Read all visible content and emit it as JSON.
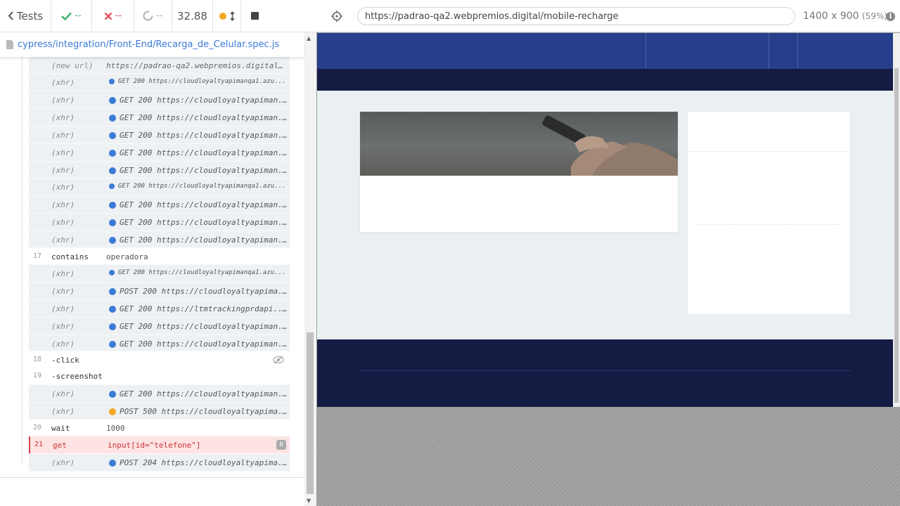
{
  "reporter": {
    "tests_label": "Tests",
    "passed": "--",
    "failed": "--",
    "pending": "--",
    "duration": "32.88",
    "spec_path": "cypress/integration/Front-End/Recarga_de_Celular.spec.js",
    "commands": [
      {
        "num": "",
        "name": "(new url)",
        "msg": "https://padrao-qa2.webpremios.digital..."
      },
      {
        "num": "",
        "name": "(xhr)",
        "msg": "GET 200 https://cloudloyaltyapimanqa1.azu...",
        "dot": "blue"
      },
      {
        "num": "",
        "name": "(xhr)",
        "msg": "GET 200 https://cloudloyaltyapiman...",
        "dot": "blue"
      },
      {
        "num": "",
        "name": "(xhr)",
        "msg": "GET 200 https://cloudloyaltyapiman...",
        "dot": "blue"
      },
      {
        "num": "",
        "name": "(xhr)",
        "msg": "GET 200 https://cloudloyaltyapiman...",
        "dot": "blue"
      },
      {
        "num": "",
        "name": "(xhr)",
        "msg": "GET 200 https://cloudloyaltyapiman...",
        "dot": "blue"
      },
      {
        "num": "",
        "name": "(xhr)",
        "msg": "GET 200 https://cloudloyaltyapiman...",
        "dot": "blue"
      },
      {
        "num": "",
        "name": "(xhr)",
        "msg": "GET 200 https://cloudloyaltyapimanqa1.azu...",
        "dot": "blue"
      },
      {
        "num": "",
        "name": "(xhr)",
        "msg": "GET 200 https://cloudloyaltyapiman...",
        "dot": "blue"
      },
      {
        "num": "",
        "name": "(xhr)",
        "msg": "GET 200 https://cloudloyaltyapiman...",
        "dot": "blue"
      },
      {
        "num": "",
        "name": "(xhr)",
        "msg": "GET 200 https://cloudloyaltyapiman...",
        "dot": "blue"
      },
      {
        "num": "17",
        "name": "contains",
        "msg": "operadora"
      },
      {
        "num": "",
        "name": "(xhr)",
        "msg": "GET 200 https://cloudloyaltyapimanqa1.azu...",
        "dot": "blue"
      },
      {
        "num": "",
        "name": "(xhr)",
        "msg": "POST 200 https://cloudloyaltyapima...",
        "dot": "blue"
      },
      {
        "num": "",
        "name": "(xhr)",
        "msg": "GET 200 https://ltmtrackingprdapi....",
        "dot": "blue"
      },
      {
        "num": "",
        "name": "(xhr)",
        "msg": "GET 200 https://cloudloyaltyapiman...",
        "dot": "blue"
      },
      {
        "num": "",
        "name": "(xhr)",
        "msg": "GET 200 https://cloudloyaltyapiman...",
        "dot": "blue"
      },
      {
        "num": "18",
        "name": "-click",
        "msg": ""
      },
      {
        "num": "19",
        "name": "-screenshot",
        "msg": ""
      },
      {
        "num": "",
        "name": "(xhr)",
        "msg": "GET 200 https://cloudloyaltyapiman...",
        "dot": "blue"
      },
      {
        "num": "",
        "name": "(xhr)",
        "msg": "POST 500 https://cloudloyaltyapima...",
        "dot": "orange"
      },
      {
        "num": "20",
        "name": "wait",
        "msg": "1000"
      },
      {
        "num": "21",
        "name": "get",
        "msg": "input[id=\"telefone\"]",
        "badge": "0"
      },
      {
        "num": "",
        "name": "(xhr)",
        "msg": "POST 204 https://cloudloyaltyapima...",
        "dot": "blue"
      }
    ]
  },
  "aut": {
    "url": "https://padrao-qa2.webpremios.digital/mobile-recharge",
    "viewport": "1400 x 900",
    "scale": "(59%)"
  },
  "colors": {
    "nav_primary": "#263f8c",
    "nav_dark": "#141c44",
    "page_bg": "#eaf0f2",
    "xhr_dot": "#3a7bd5",
    "xhr_dot_error": "#f5a623",
    "fail": "#e0454d",
    "pass": "#3cb371"
  }
}
